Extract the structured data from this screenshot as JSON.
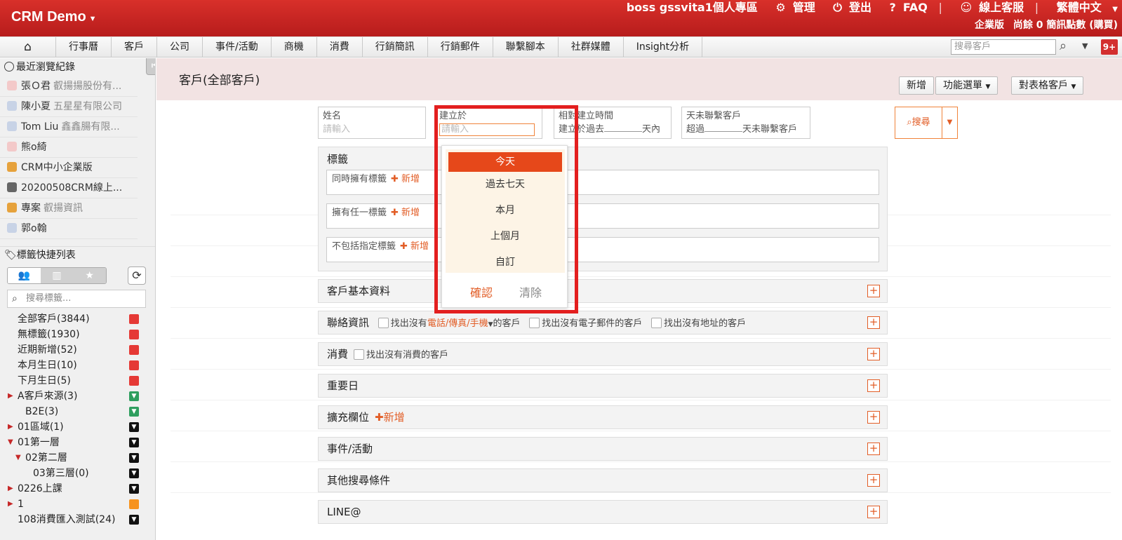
{
  "app": {
    "brand": "CRM Demo",
    "user": "boss gssvita1個人專區",
    "manage": "管理",
    "logout": "登出",
    "faq": "FAQ",
    "support": "線上客服",
    "language": "繁體中文",
    "edition": "企業版",
    "sms_balance": "尚餘 0 簡訊點數 (購買)"
  },
  "nav": {
    "items": [
      "行事曆",
      "客戶",
      "公司",
      "事件/活動",
      "商機",
      "消費",
      "行銷簡訊",
      "行銷郵件",
      "聯繫腳本",
      "社群媒體",
      "Insight分析"
    ],
    "search_placeholder": "搜尋客戶",
    "badge": "9+"
  },
  "sidebar": {
    "recent_title": "最近瀏覽紀錄",
    "recent": [
      {
        "name": "張Ｏ君",
        "sub": "叡揚揚股份有..."
      },
      {
        "name": "陳小夏",
        "sub": "五星星有限公司"
      },
      {
        "name": "Tom Liu",
        "sub": "鑫鑫腸有限..."
      },
      {
        "name": "熊o綺",
        "sub": ""
      },
      {
        "name": "CRM中小企業版",
        "sub": ""
      },
      {
        "name": "20200508CRM線上...",
        "sub": ""
      },
      {
        "name": "專案",
        "sub": "叡揚資訊"
      },
      {
        "name": "郭o翰",
        "sub": ""
      }
    ],
    "tags_title": "標籤快捷列表",
    "tag_search_placeholder": "搜尋標籤...",
    "tags": [
      {
        "label": "全部客戶(3844)",
        "indent": 25,
        "arrow": "",
        "color": "red"
      },
      {
        "label": "無標籤(1930)",
        "indent": 25,
        "arrow": "",
        "color": "red"
      },
      {
        "label": "近期新增(52)",
        "indent": 25,
        "arrow": "",
        "color": "red"
      },
      {
        "label": "本月生日(10)",
        "indent": 25,
        "arrow": "",
        "color": "red"
      },
      {
        "label": "下月生日(5)",
        "indent": 25,
        "arrow": "",
        "color": "red"
      },
      {
        "label": "A客戶來源(3)",
        "indent": 25,
        "arrow": "▶",
        "color": "green"
      },
      {
        "label": "B2E(3)",
        "indent": 36,
        "arrow": "",
        "color": "green"
      },
      {
        "label": "01區域(1)",
        "indent": 25,
        "arrow": "▶",
        "color": "black"
      },
      {
        "label": "01第一層",
        "indent": 25,
        "arrow": "▼",
        "color": "black"
      },
      {
        "label": "02第二層",
        "indent": 36,
        "arrow": "▼",
        "color": "black"
      },
      {
        "label": "03第三層(0)",
        "indent": 47,
        "arrow": "",
        "color": "black"
      },
      {
        "label": "0226上課",
        "indent": 25,
        "arrow": "▶",
        "color": "black"
      },
      {
        "label": "1",
        "indent": 25,
        "arrow": "▶",
        "color": "orange"
      },
      {
        "label": "108消費匯入測試(24)",
        "indent": 25,
        "arrow": "",
        "color": "black"
      }
    ]
  },
  "main": {
    "title": "客戶(全部客戶)",
    "buttons": {
      "add": "新增",
      "menu": "功能選單",
      "view": "對表格客戶"
    },
    "fields": {
      "name_label": "姓名",
      "name_placeholder": "請輸入",
      "created_label": "建立於",
      "created_placeholder": "請輸入",
      "relative_label": "相對建立時間",
      "relative_prefix": "建立於過去",
      "relative_suffix": "天內",
      "nocontact_label": "天未聯繫客戶",
      "nocontact_prefix": "超過",
      "nocontact_suffix": "天未聯繫客戶"
    },
    "search_button": "搜尋",
    "tags_panel": {
      "title": "標籤",
      "conditions": [
        "同時擁有標籤",
        "擁有任一標籤",
        "不包括指定標籤"
      ],
      "add": "新增"
    },
    "sections": {
      "basic": "客戶基本資料",
      "contact": "聯絡資訊",
      "contact_opt1_pre": "找出沒有",
      "contact_opt1_hl": "電話/傳真/手機",
      "contact_opt1_post": "的客戶",
      "contact_opt2": "找出沒有電子郵件的客戶",
      "contact_opt3": "找出沒有地址的客戶",
      "consume": "消費",
      "consume_opt": "找出沒有消費的客戶",
      "important": "重要日",
      "ext": "擴充欄位",
      "ext_add": "新增",
      "events": "事件/活動",
      "other": "其他搜尋條件",
      "line": "LINE@"
    },
    "date_dropdown": {
      "options": [
        "今天",
        "過去七天",
        "本月",
        "上個月",
        "自訂"
      ],
      "confirm": "確認",
      "clear": "清除"
    }
  }
}
